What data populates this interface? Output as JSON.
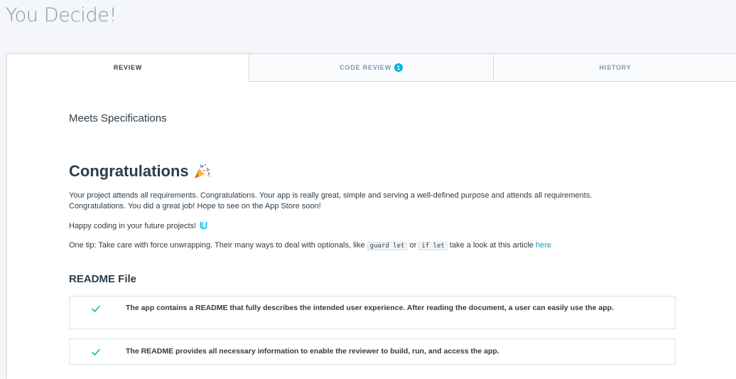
{
  "page": {
    "title": "You Decide!"
  },
  "tabs": [
    {
      "label": "REVIEW",
      "active": true
    },
    {
      "label": "CODE REVIEW",
      "badge": "1",
      "active": false
    },
    {
      "label": "HISTORY",
      "active": false
    }
  ],
  "review": {
    "status": "Meets Specifications",
    "heading": "Congratulations",
    "heading_icon": "party-popper-icon",
    "paragraph1": "Your project attends all requirements. Congratulations. Your app is really great, simple and serving a well-defined purpose and attends all requirements. Congratulations. You did a great job! Hope to see on the App Store soon!",
    "paragraph2": "Happy coding in your future projects!",
    "paragraph2_icon": "udacity-logo-icon",
    "tip_prefix": "One tip: Take care with force unwrapping. Their many ways to deal with optionals, like",
    "tip_code1": "guard let",
    "tip_or": "or",
    "tip_code2": "if let",
    "tip_suffix": "take a look at this article",
    "tip_link": "here"
  },
  "section": {
    "title": "README File",
    "items": [
      {
        "status": "met",
        "icon": "check-icon",
        "text": "The app contains a README that fully describes the intended user experience. After reading the document, a user can easily use the app."
      },
      {
        "status": "met",
        "icon": "check-icon",
        "text": "The README provides all necessary information to enable the reviewer to build, run, and access the app."
      }
    ]
  },
  "colors": {
    "accent": "#02b3e4",
    "check": "#15c26b",
    "title": "#7d97ad",
    "text": "#2e3d49"
  }
}
